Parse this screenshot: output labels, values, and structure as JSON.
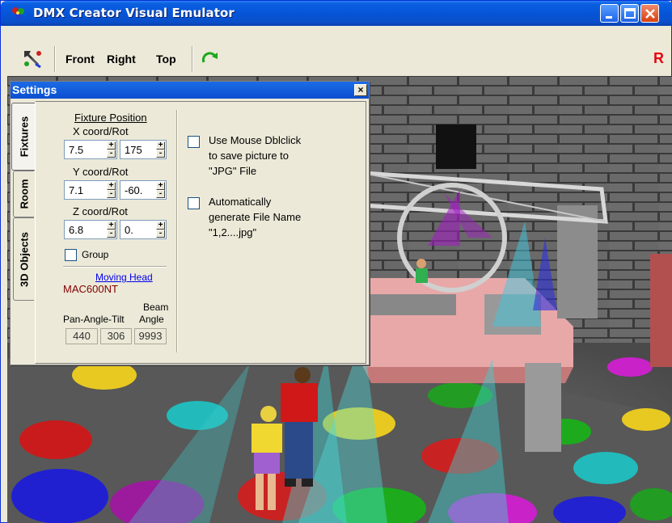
{
  "window": {
    "title": "DMX Creator Visual Emulator"
  },
  "toolbar": {
    "front_label": "Front",
    "right_label": "Right",
    "top_label": "Top",
    "r_label": "R"
  },
  "settings": {
    "title": "Settings",
    "close_label": "×",
    "tabs": [
      "Fixtures",
      "Room",
      "3D Objects"
    ],
    "fixtures": {
      "section_title": "Fixture Position",
      "x_label": "X coord/Rot",
      "x_value": "7.5",
      "x_rot": "175",
      "y_label": "Y coord/Rot",
      "y_value": "7.1",
      "y_rot": "-60.",
      "z_label": "Z coord/Rot",
      "z_value": "6.8",
      "z_rot": "0.",
      "group_label": "Group",
      "fixture_type_link": "Moving Head",
      "fixture_model": "MAC600NT",
      "pan_tilt_label": "Pan-Angle-Tilt",
      "beam_label_1": "Beam",
      "beam_label_2": "Angle",
      "pan_value": "440",
      "tilt_value": "306",
      "beam_value": "9993"
    },
    "options": {
      "dblclick_line1": "Use Mouse Dblclick",
      "dblclick_line2": "to save picture to",
      "dblclick_line3": "\"JPG\" File",
      "autoname_line1": "Automatically",
      "autoname_line2": "generate File Name",
      "autoname_line3": "\"1,2....jpg\""
    }
  }
}
